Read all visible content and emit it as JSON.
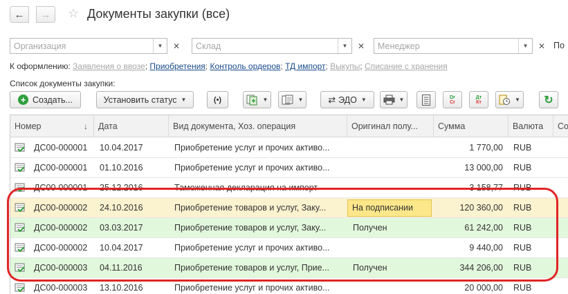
{
  "window": {
    "title": "Документы закупки (все)"
  },
  "filters": {
    "organization_placeholder": "Организация",
    "warehouse_placeholder": "Склад",
    "manager_placeholder": "Менеджер",
    "cut_label": "По"
  },
  "links": {
    "prefix": "К оформлению:",
    "items": [
      {
        "label": "Заявления о ввозе",
        "dim": true
      },
      {
        "label": "Приобретения",
        "dim": false
      },
      {
        "label": "Контроль ордеров",
        "dim": false
      },
      {
        "label": "ТД импорт",
        "dim": false
      },
      {
        "label": "Выкупы",
        "dim": true
      },
      {
        "label": "Списание с хранения",
        "dim": true
      }
    ]
  },
  "list_label": "Список документы закупки:",
  "toolbar": {
    "create_label": "Создать...",
    "set_status_label": "Установить статус",
    "edo_label": "ЭДО"
  },
  "table": {
    "columns": [
      "Номер",
      "Дата",
      "Вид документа, Хоз. операция",
      "Оригинал полу...",
      "Сумма",
      "Валюта",
      "Со"
    ],
    "rows": [
      {
        "number": "ДС00-000001",
        "date": "10.04.2017",
        "type": "Приобретение услуг и прочих активо...",
        "original": "",
        "sum": "1 770,00",
        "currency": "RUB",
        "hl": "none"
      },
      {
        "number": "ДС00-000001",
        "date": "01.10.2016",
        "type": "Приобретение услуг и прочих активо...",
        "original": "",
        "sum": "13 000,00",
        "currency": "RUB",
        "hl": "none"
      },
      {
        "number": "ДС00-000001",
        "date": "25.12.2016",
        "type": "Таможенная декларация на импорт",
        "original": "",
        "sum": "3 158,77",
        "currency": "RUB",
        "hl": "none"
      },
      {
        "number": "ДС00-000002",
        "date": "24.10.2016",
        "type": "Приобретение товаров и услуг, Заку...",
        "original": "На подписании",
        "sum": "120 360,00",
        "currency": "RUB",
        "hl": "yellow"
      },
      {
        "number": "ДС00-000002",
        "date": "03.03.2017",
        "type": "Приобретение товаров и услуг, Заку...",
        "original": "Получен",
        "sum": "61 242,00",
        "currency": "RUB",
        "hl": "green"
      },
      {
        "number": "ДС00-000002",
        "date": "10.04.2017",
        "type": "Приобретение услуг и прочих активо...",
        "original": "",
        "sum": "9 440,00",
        "currency": "RUB",
        "hl": "none"
      },
      {
        "number": "ДС00-000003",
        "date": "04.11.2016",
        "type": "Приобретение товаров и услуг, Прие...",
        "original": "Получен",
        "sum": "344 206,00",
        "currency": "RUB",
        "hl": "green"
      },
      {
        "number": "ДС00-000003",
        "date": "13.10.2016",
        "type": "Приобретение услуг и прочих активо...",
        "original": "",
        "sum": "20 000,00",
        "currency": "RUB",
        "hl": "none"
      }
    ]
  },
  "colors": {
    "status_pending_bg": "#fce78a",
    "row_yellow_bg": "#fbf2cf",
    "row_green_bg": "#e2f8dc",
    "highlight_frame": "#e02424",
    "link_color": "#1a4b8c"
  }
}
